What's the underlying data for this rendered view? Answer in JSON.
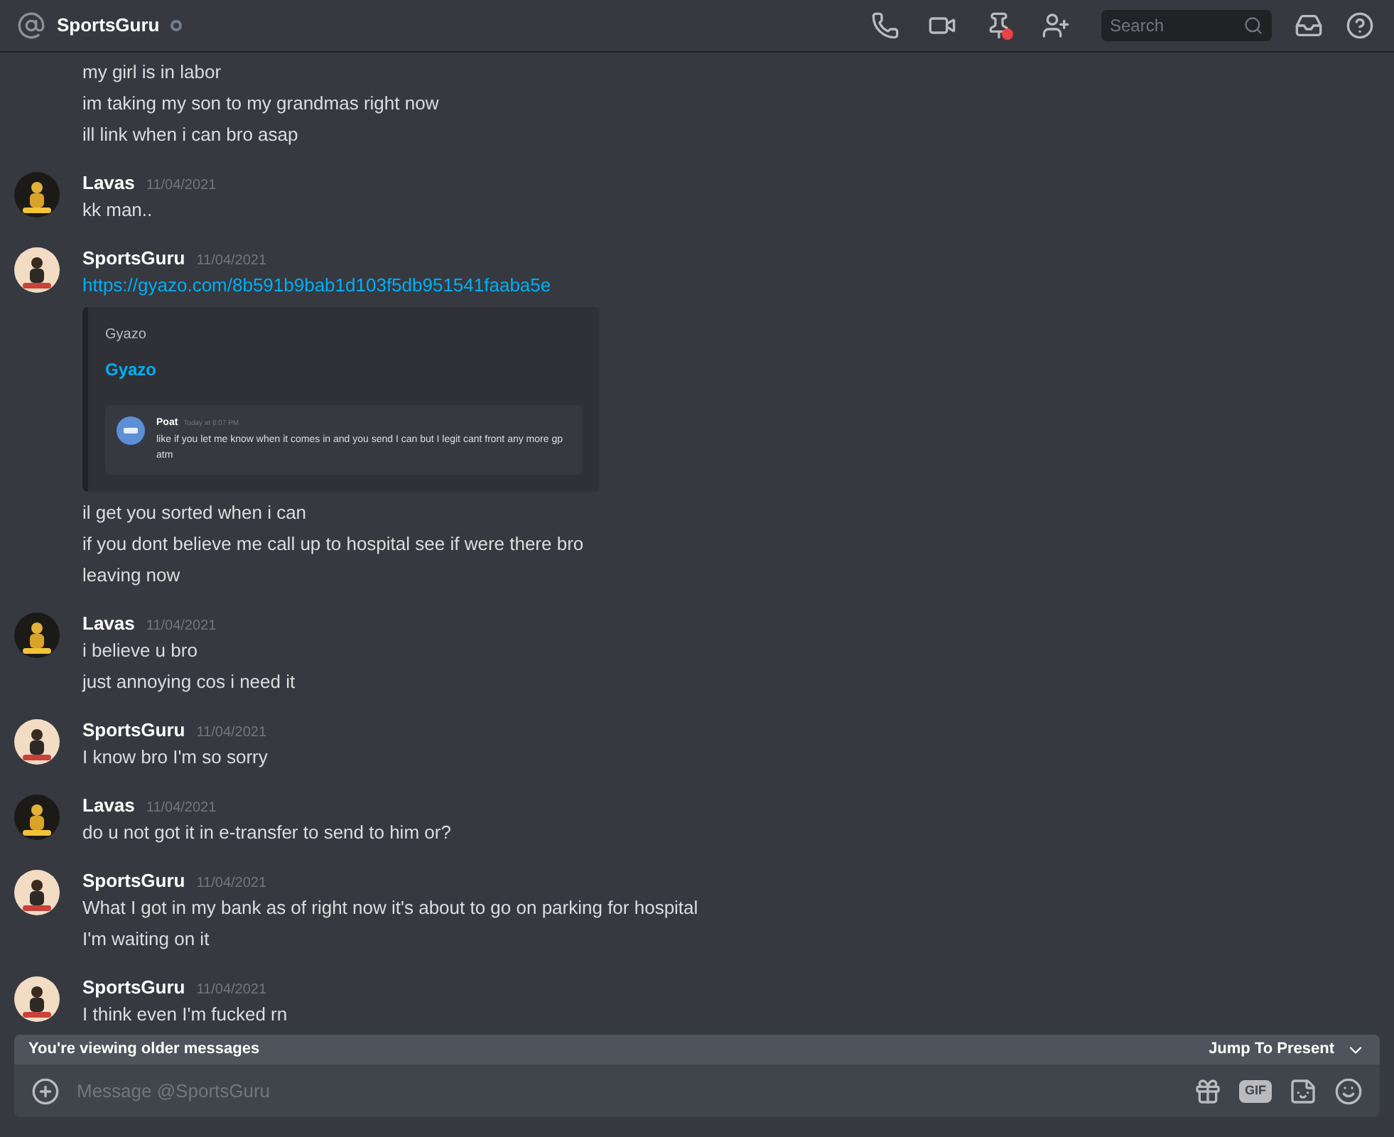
{
  "header": {
    "title": "SportsGuru",
    "search": {
      "placeholder": "Search"
    }
  },
  "messages": [
    {
      "lines": [
        {
          "kind": "text",
          "text": "my girl is in labor"
        },
        {
          "kind": "text",
          "text": "im taking my son to my grandmas right now"
        },
        {
          "kind": "text",
          "text": "ill link when i can bro asap"
        }
      ]
    },
    {
      "author": "Lavas",
      "timestamp": "11/04/2021",
      "avatar": {
        "color": "#1c1a16"
      },
      "lines": [
        {
          "kind": "text",
          "text": "kk man.."
        }
      ]
    },
    {
      "author": "SportsGuru",
      "timestamp": "11/04/2021",
      "avatar": {
        "color": "#f2dcc4"
      },
      "lines": [
        {
          "kind": "link",
          "text": "https://gyazo.com/8b591b9bab1d103f5db951541faaba5e"
        },
        {
          "kind": "embed",
          "provider": "Gyazo",
          "title": "Gyazo",
          "quote": {
            "author": "Poat",
            "time": "Today at 8:07 PM",
            "text": "like if you let me know when it comes in and you send I can but I legit cant front any more gp atm"
          }
        },
        {
          "kind": "text",
          "text": "il get you sorted when i can"
        },
        {
          "kind": "text",
          "text": "if you dont believe me call up to hospital see if were there bro"
        },
        {
          "kind": "text",
          "text": "leaving now"
        }
      ]
    },
    {
      "author": "Lavas",
      "timestamp": "11/04/2021",
      "avatar": {
        "color": "#1c1a16"
      },
      "lines": [
        {
          "kind": "text",
          "text": "i believe u bro"
        },
        {
          "kind": "text",
          "text": "just annoying cos i need it"
        }
      ]
    },
    {
      "author": "SportsGuru",
      "timestamp": "11/04/2021",
      "avatar": {
        "color": "#f2dcc4"
      },
      "lines": [
        {
          "kind": "text",
          "text": "I know bro I'm so sorry"
        }
      ]
    },
    {
      "author": "Lavas",
      "timestamp": "11/04/2021",
      "avatar": {
        "color": "#1c1a16"
      },
      "lines": [
        {
          "kind": "text",
          "text": "do u not got it in e-transfer to send to him or?"
        }
      ]
    },
    {
      "author": "SportsGuru",
      "timestamp": "11/04/2021",
      "avatar": {
        "color": "#f2dcc4"
      },
      "lines": [
        {
          "kind": "text",
          "text": "What I got in my bank as of right now it's about to go on parking for hospital"
        },
        {
          "kind": "text",
          "text": "I'm waiting on it"
        }
      ]
    },
    {
      "author": "SportsGuru",
      "timestamp": "11/04/2021",
      "avatar": {
        "color": "#f2dcc4"
      },
      "lines": [
        {
          "kind": "text",
          "text": "I think even I'm fucked rn"
        }
      ]
    }
  ],
  "composer": {
    "notice": "You're viewing older messages",
    "jump": "Jump To Present",
    "placeholder": "Message @SportsGuru",
    "gif": "GIF"
  }
}
